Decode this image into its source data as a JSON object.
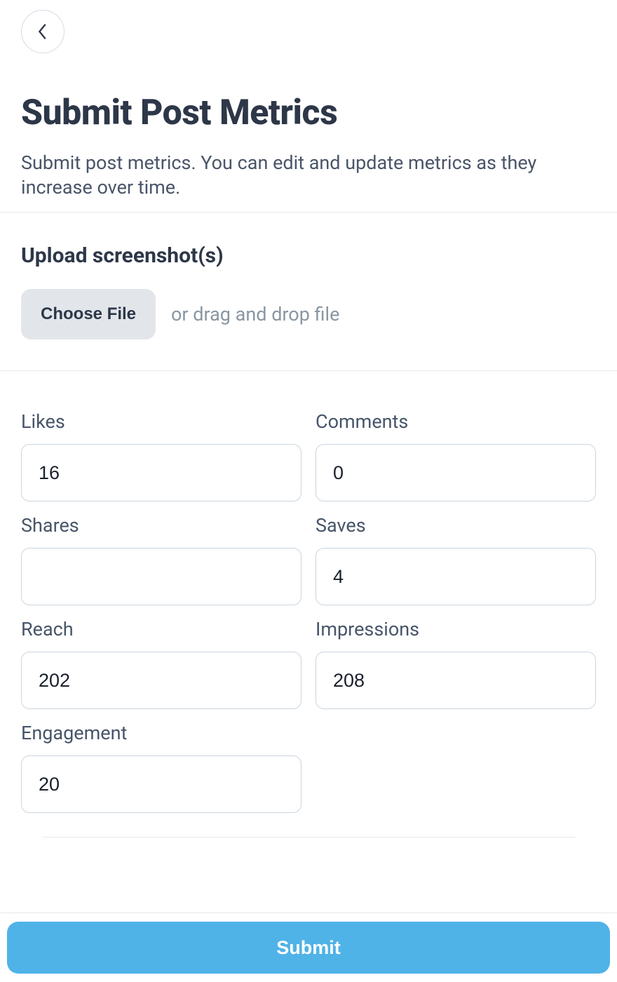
{
  "header": {
    "title": "Submit Post Metrics",
    "subtitle": "Submit post metrics. You can edit and update metrics as they increase over time."
  },
  "upload": {
    "heading": "Upload screenshot(s)",
    "button_label": "Choose File",
    "drag_hint": "or drag and drop file"
  },
  "fields": {
    "likes": {
      "label": "Likes",
      "value": "16"
    },
    "comments": {
      "label": "Comments",
      "value": "0"
    },
    "shares": {
      "label": "Shares",
      "value": ""
    },
    "saves": {
      "label": "Saves",
      "value": "4"
    },
    "reach": {
      "label": "Reach",
      "value": "202"
    },
    "impressions": {
      "label": "Impressions",
      "value": "208"
    },
    "engagement": {
      "label": "Engagement",
      "value": "20"
    }
  },
  "footer": {
    "submit_label": "Submit"
  }
}
